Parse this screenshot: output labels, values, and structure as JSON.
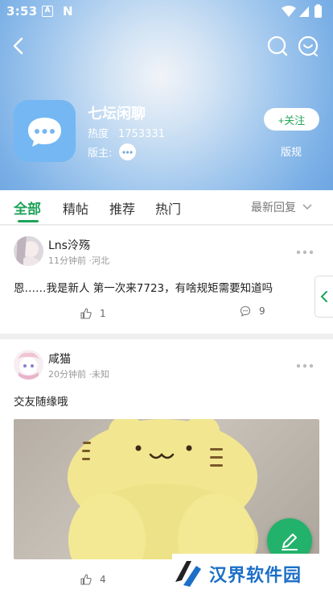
{
  "status_bar": {
    "time": "3:53",
    "a_label": "A",
    "n_label": "N"
  },
  "board": {
    "name": "七坛闲聊",
    "heat_label": "热度",
    "heat_value": "1753331",
    "moderator_label": "版主:",
    "follow_label": "+关注",
    "rules_label": "版规"
  },
  "tabs": [
    {
      "label": "全部",
      "active": true
    },
    {
      "label": "精帖",
      "active": false
    },
    {
      "label": "推荐",
      "active": false
    },
    {
      "label": "热门",
      "active": false
    }
  ],
  "sort_label": "最新回复",
  "posts": [
    {
      "username": "Lns泠殇",
      "meta": "11分钟前 ·河北",
      "content": "恩……我是新人 第一次来7723，有啥规矩需要知道吗",
      "likes": "1",
      "comments": "9"
    },
    {
      "username": "咸猫",
      "meta": "20分钟前 ·未知",
      "content": "交友随缘哦",
      "likes": "4"
    }
  ],
  "watermark": "汉界软件园",
  "colors": {
    "accent": "#1ea35a",
    "header": "#7bb0e6",
    "fab": "#23b26b"
  }
}
